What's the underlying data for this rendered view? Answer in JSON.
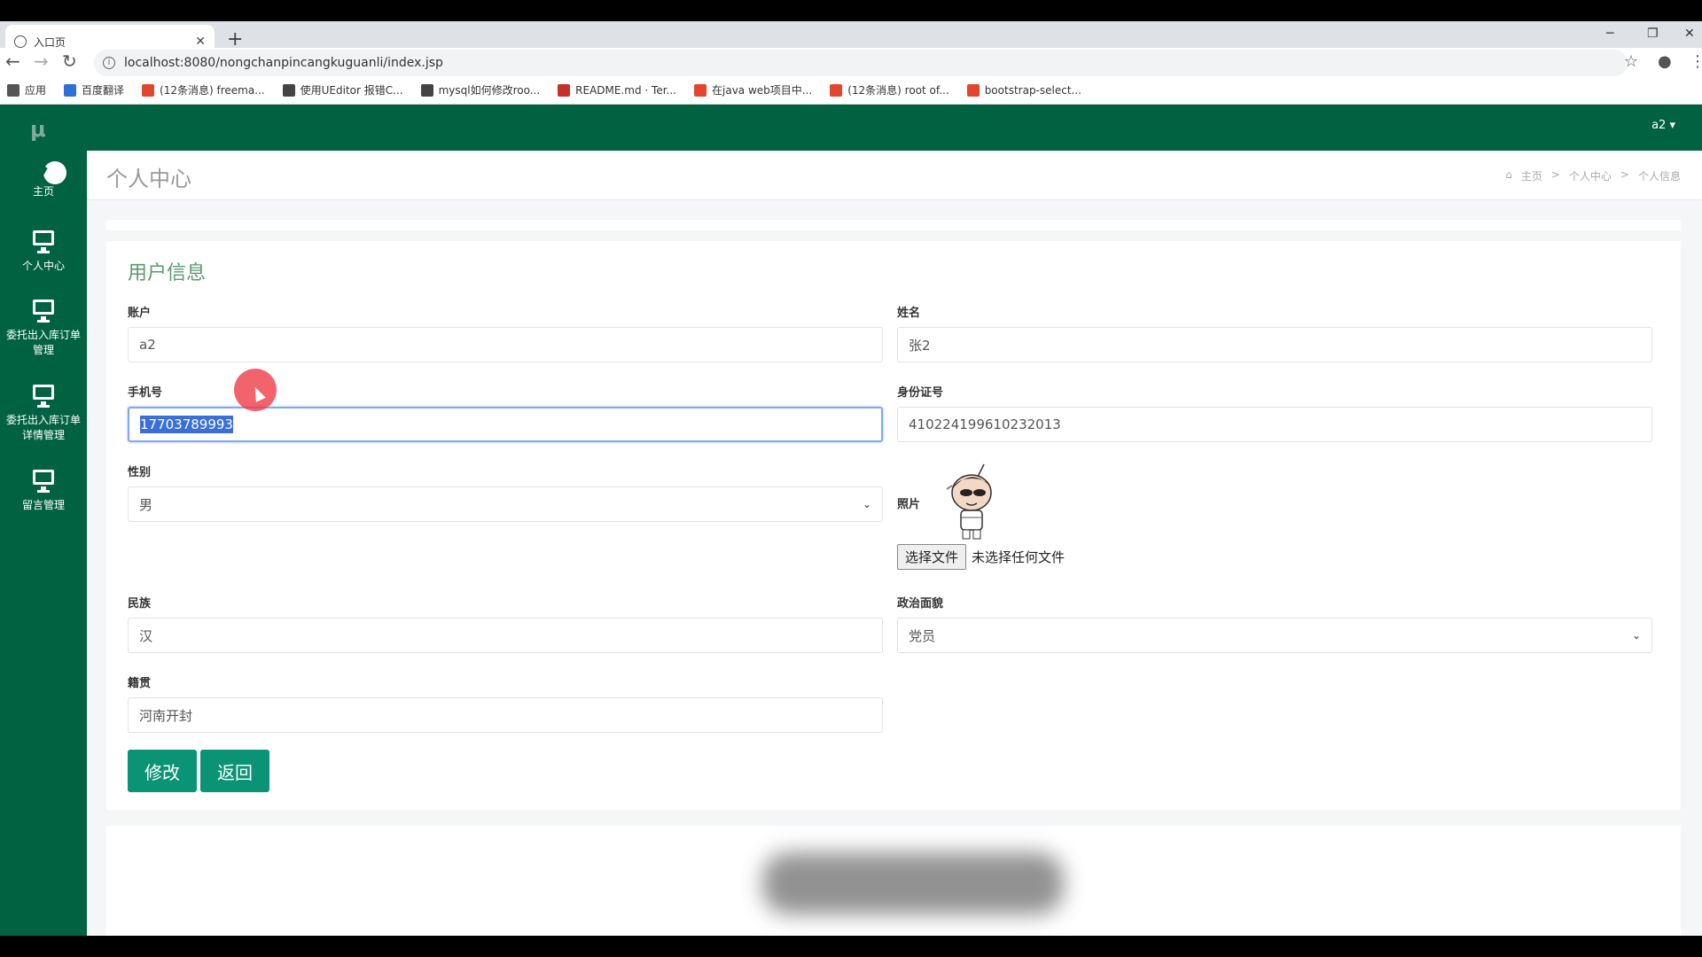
{
  "browser": {
    "tab_title": "入口页",
    "url": "localhost:8080/nongchanpincangkuguanli/index.jsp",
    "bookmarks": [
      {
        "label": "应用",
        "color": "#555555"
      },
      {
        "label": "百度翻译",
        "color": "#2f6fd6"
      },
      {
        "label": "(12条消息) freema...",
        "color": "#e2462f"
      },
      {
        "label": "使用UEditor 报错C...",
        "color": "#444444"
      },
      {
        "label": "mysql如何修改roo...",
        "color": "#444444"
      },
      {
        "label": "README.md · Ter...",
        "color": "#c6302a"
      },
      {
        "label": "在java web项目中...",
        "color": "#e2462f"
      },
      {
        "label": "(12条消息) root of...",
        "color": "#e2462f"
      },
      {
        "label": "bootstrap-select...",
        "color": "#e2462f"
      }
    ]
  },
  "app": {
    "logo": "μ",
    "user": "a2 ▾",
    "nav": [
      {
        "label": "主页",
        "icon": "dashboard-icon"
      },
      {
        "label": "个人中心",
        "icon": "monitor-icon"
      },
      {
        "label": "委托出入库订单管理",
        "icon": "monitor-icon"
      },
      {
        "label": "委托出入库订单详情管理",
        "icon": "monitor-icon"
      },
      {
        "label": "留言管理",
        "icon": "monitor-icon"
      }
    ],
    "page_title": "个人中心",
    "breadcrumb": [
      "主页",
      ">",
      "个人中心",
      ">",
      "个人信息"
    ]
  },
  "form": {
    "section_title": "用户信息",
    "account_label": "账户",
    "account_value": "a2",
    "name_label": "姓名",
    "name_value": "张2",
    "phone_label": "手机号",
    "phone_value": "17703789993",
    "idcard_label": "身份证号",
    "idcard_value": "410224199610232013",
    "gender_label": "性别",
    "gender_value": "男",
    "photo_label": "照片",
    "file_button": "选择文件",
    "file_status": "未选择任何文件",
    "ethnic_label": "民族",
    "ethnic_value": "汉",
    "political_label": "政治面貌",
    "political_value": "党员",
    "native_label": "籍贯",
    "native_value": "河南开封",
    "submit_label": "修改",
    "back_label": "返回"
  },
  "colors": {
    "brand_green": "#006241",
    "button_green": "#0b9375",
    "section_title": "#5a9a6e"
  }
}
